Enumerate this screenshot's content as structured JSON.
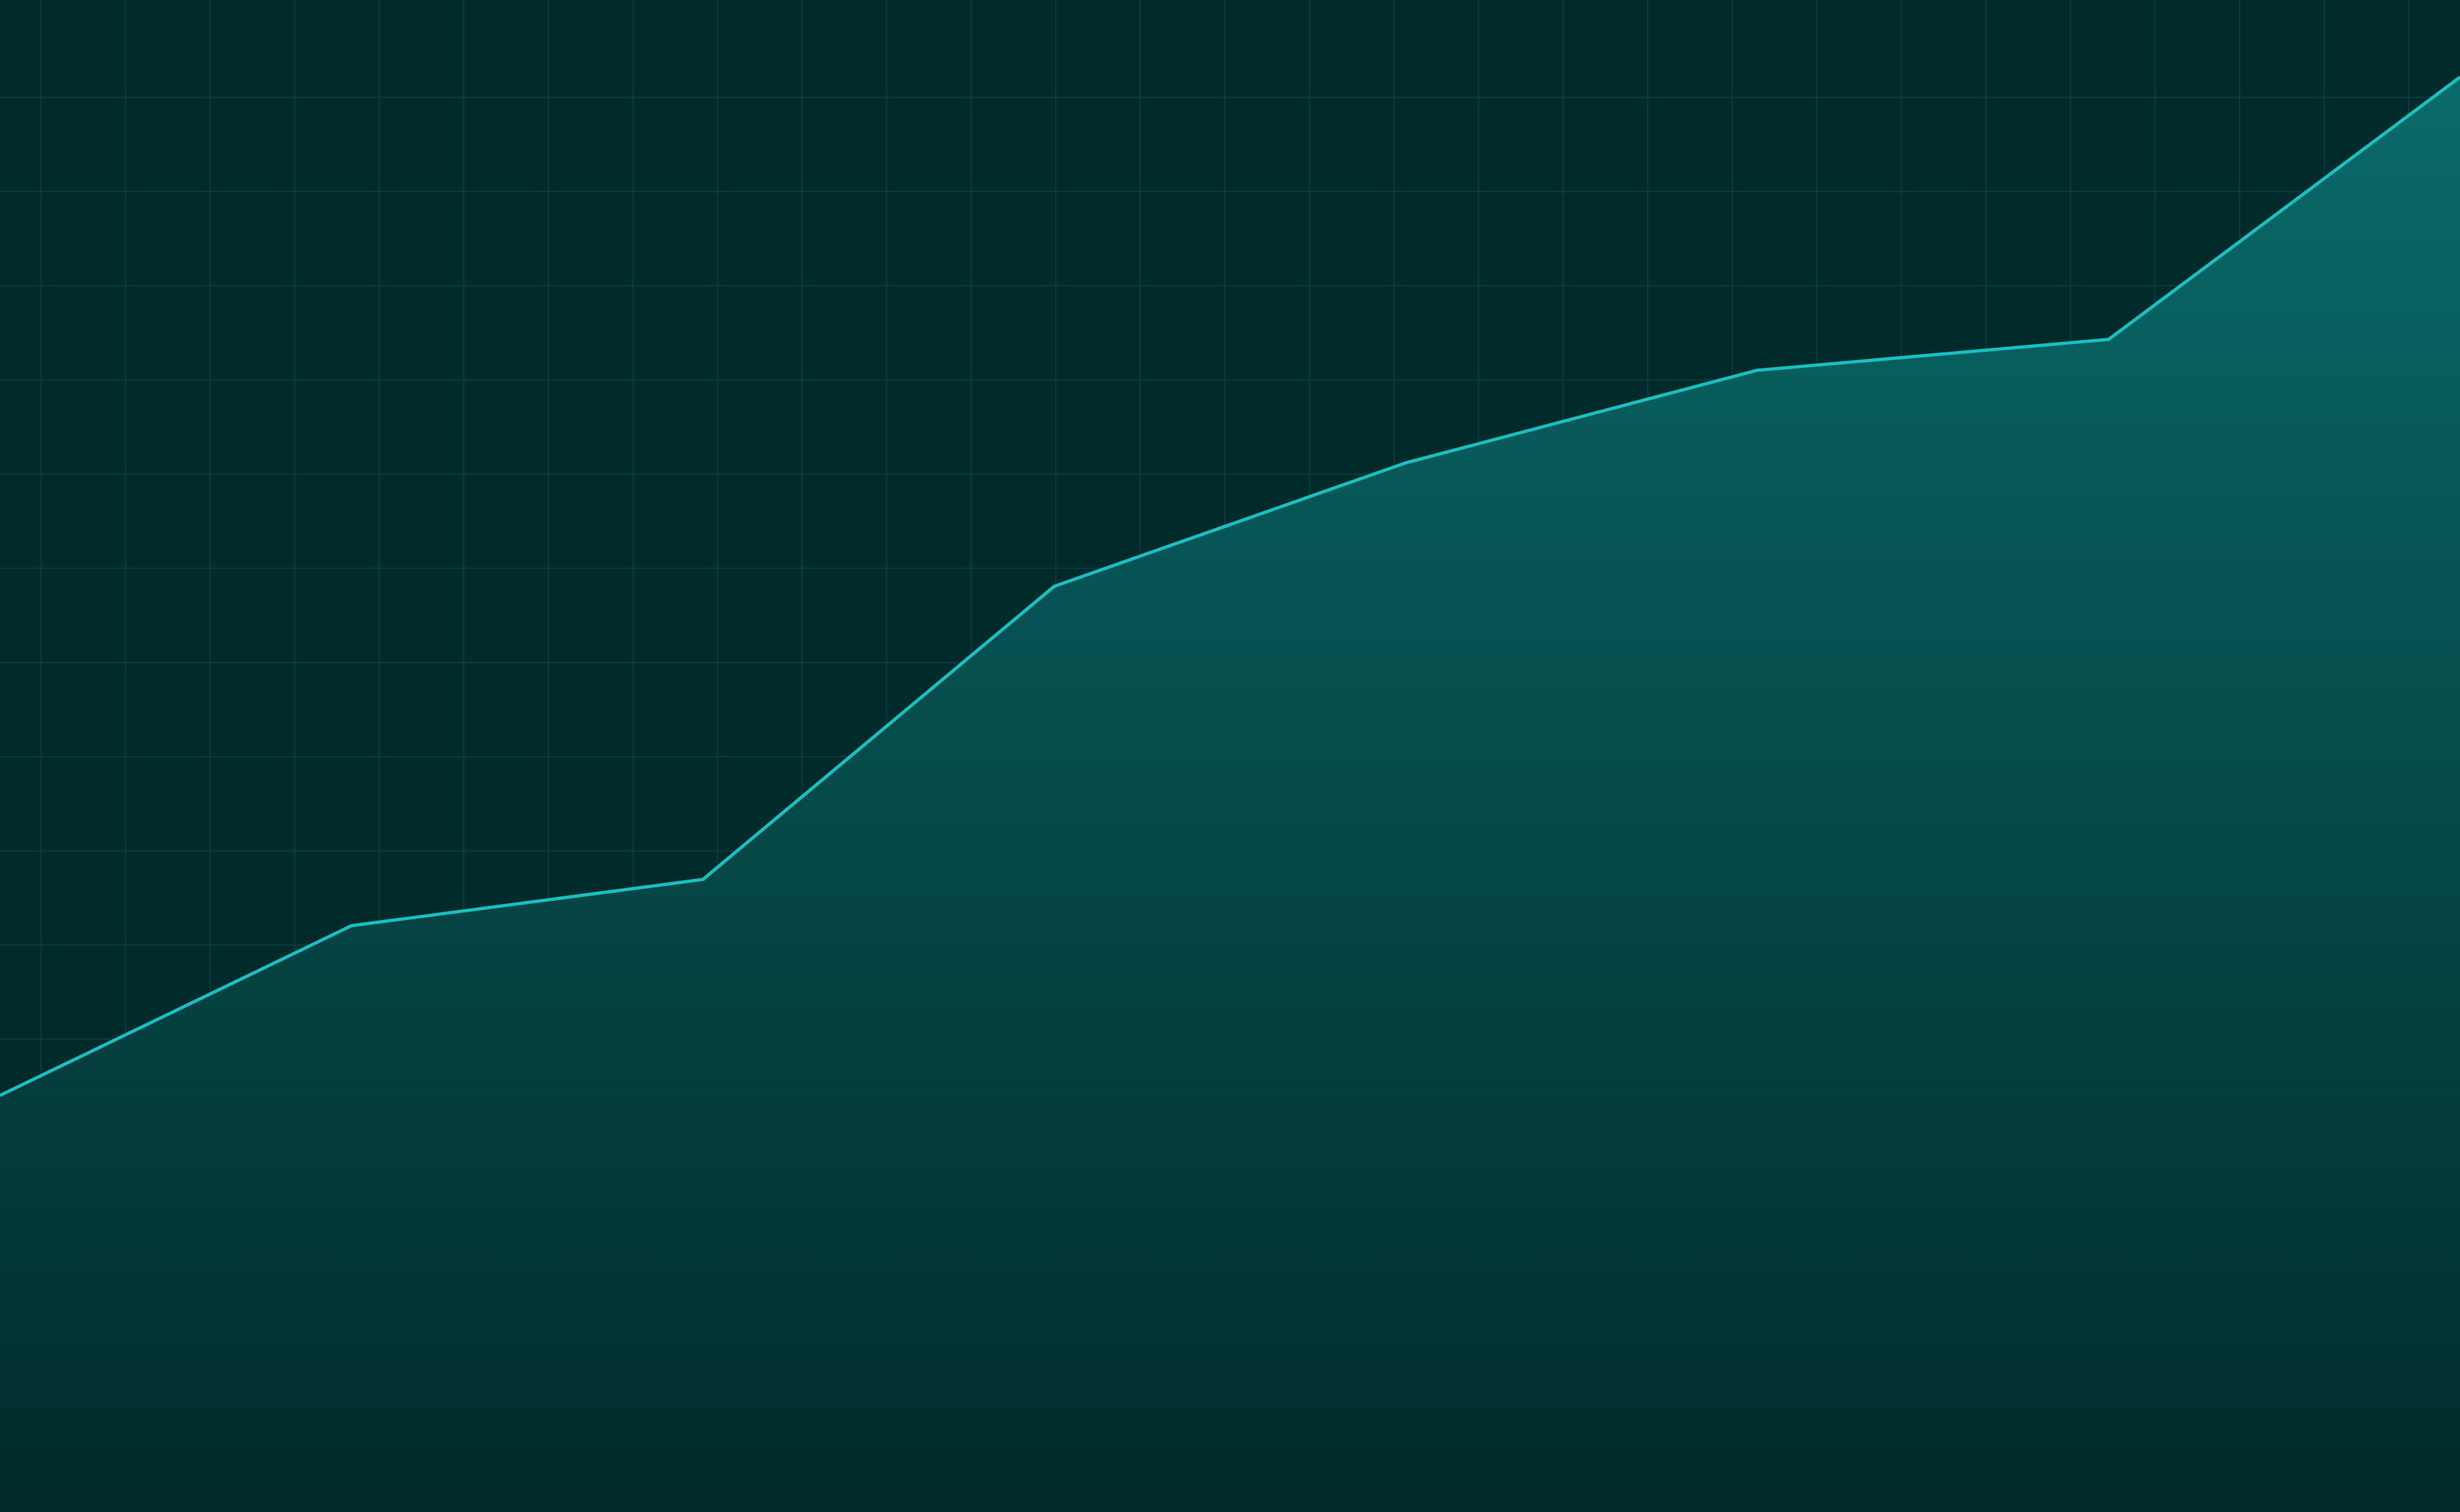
{
  "chart_data": {
    "type": "area",
    "title": "",
    "xlabel": "",
    "ylabel": "",
    "grid": true,
    "legend": "none",
    "x": [
      0,
      1,
      2,
      3,
      4,
      5,
      6,
      7
    ],
    "series": [
      {
        "values": [
          27,
          38,
          41,
          60,
          68,
          74,
          76,
          93
        ]
      }
    ],
    "xlim": [
      0,
      7
    ],
    "ylim": [
      0,
      98
    ],
    "colors": {
      "background": "#012a2a",
      "line": "#19c2c2",
      "fill_top": "#0a6a6a",
      "fill_bottom": "#012a2a",
      "grid": "#0b4b4b"
    }
  }
}
